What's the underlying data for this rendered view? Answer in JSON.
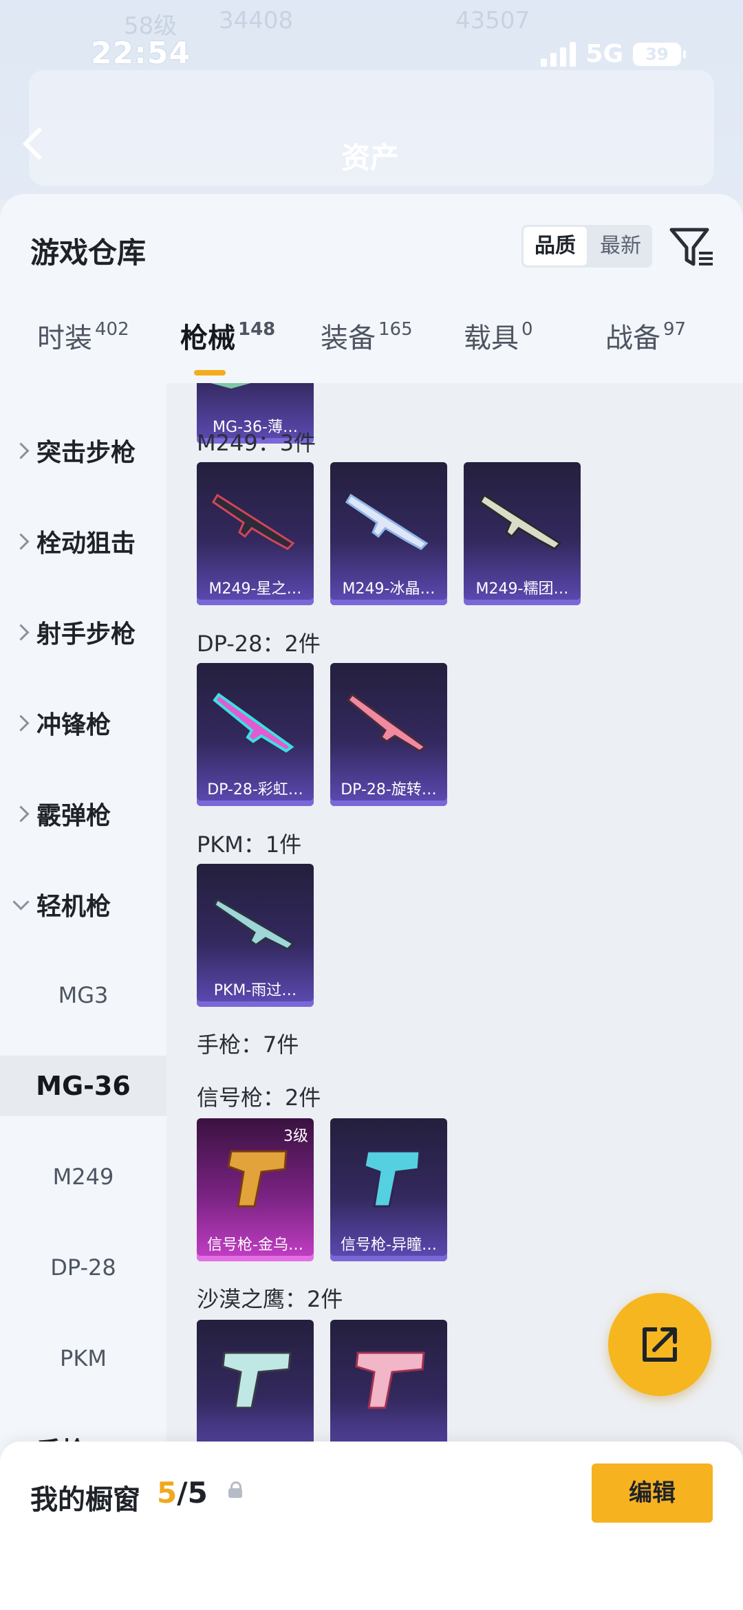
{
  "status_bar": {
    "time": "22:54",
    "network": "5G",
    "battery": "39"
  },
  "background_page": {
    "title": "资产",
    "faint_texts": [
      "58级",
      "34408",
      "43507"
    ]
  },
  "sheet": {
    "title": "游戏仓库",
    "sort_options": [
      "品质",
      "最新"
    ],
    "sort_selected": "品质"
  },
  "tabs": [
    {
      "label": "时装",
      "count": "402"
    },
    {
      "label": "枪械",
      "count": "148"
    },
    {
      "label": "装备",
      "count": "165"
    },
    {
      "label": "载具",
      "count": "0"
    },
    {
      "label": "战备",
      "count": "97"
    }
  ],
  "active_tab": "枪械",
  "categories": {
    "assault_rifle": "突击步枪",
    "bolt_sniper": "栓动狙击",
    "marksman_rifle": "射手步枪",
    "smg": "冲锋枪",
    "shotgun": "霰弹枪",
    "lmg": "轻机枪",
    "lmg_subs": [
      "MG3",
      "MG-36",
      "M249",
      "DP-28",
      "PKM"
    ],
    "pistol": "手枪"
  },
  "active_subcategory": "MG-36",
  "content": {
    "top_card": "MG-36-薄…",
    "m249_header": "M249：3件",
    "m249_items": [
      "M249-星之…",
      "M249-冰晶…",
      "M249-糯团…"
    ],
    "dp28_header": "DP-28：2件",
    "dp28_items": [
      "DP-28-彩虹…",
      "DP-28-旋转…"
    ],
    "pkm_header": "PKM：1件",
    "pkm_items": [
      "PKM-雨过…"
    ],
    "pistol_header": "手枪：7件",
    "flare_header": "信号枪：2件",
    "flare_items": [
      "信号枪-金乌…",
      "信号枪-异瞳…"
    ],
    "flare_level": "3级",
    "deagle_header": "沙漠之鹰：2件"
  },
  "bottom_bar": {
    "label": "我的橱窗",
    "count_current": "5",
    "count_total": "/5",
    "edit_button": "编辑"
  },
  "colors": {
    "accent": "#f6b61f",
    "card_purple": "#5f4bb6",
    "card_gold": "#c53fc6"
  }
}
